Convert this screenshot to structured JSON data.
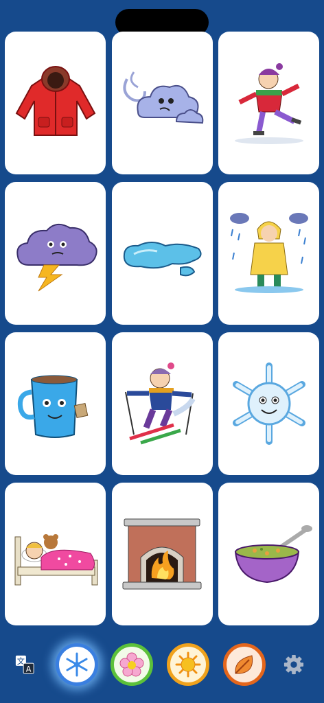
{
  "cards": [
    {
      "name": "winter-coat-card",
      "icon": "red-winter-coat"
    },
    {
      "name": "wind-cloud-card",
      "icon": "windy-cloud"
    },
    {
      "name": "ice-skating-card",
      "icon": "girl-ice-skating"
    },
    {
      "name": "storm-cloud-card",
      "icon": "thunder-cloud"
    },
    {
      "name": "puddle-card",
      "icon": "water-puddle"
    },
    {
      "name": "rain-coat-card",
      "icon": "child-in-raincoat"
    },
    {
      "name": "hot-drink-card",
      "icon": "hot-cocoa-mug"
    },
    {
      "name": "skiing-card",
      "icon": "child-skiing"
    },
    {
      "name": "snowflake-card",
      "icon": "smiling-snowflake"
    },
    {
      "name": "sleeping-card",
      "icon": "child-sleeping-in-bed"
    },
    {
      "name": "fireplace-card",
      "icon": "fireplace"
    },
    {
      "name": "soup-card",
      "icon": "soup-bowl"
    }
  ],
  "toolbar": {
    "language_icon": "translate-icon",
    "settings_icon": "gear-icon",
    "seasons": [
      {
        "name": "winter",
        "icon": "snowflake-icon",
        "ring": "#3a7fe0",
        "fill": "#ffffff",
        "active": true
      },
      {
        "name": "spring",
        "icon": "flower-icon",
        "ring": "#5cc13a",
        "fill": "#f2fbe8",
        "active": false
      },
      {
        "name": "summer",
        "icon": "sun-icon",
        "ring": "#f0a21c",
        "fill": "#fff4d6",
        "active": false
      },
      {
        "name": "autumn",
        "icon": "leaf-icon",
        "ring": "#e4661c",
        "fill": "#fde9da",
        "active": false
      }
    ]
  },
  "colors": {
    "background": "#164a8c",
    "card": "#ffffff"
  }
}
